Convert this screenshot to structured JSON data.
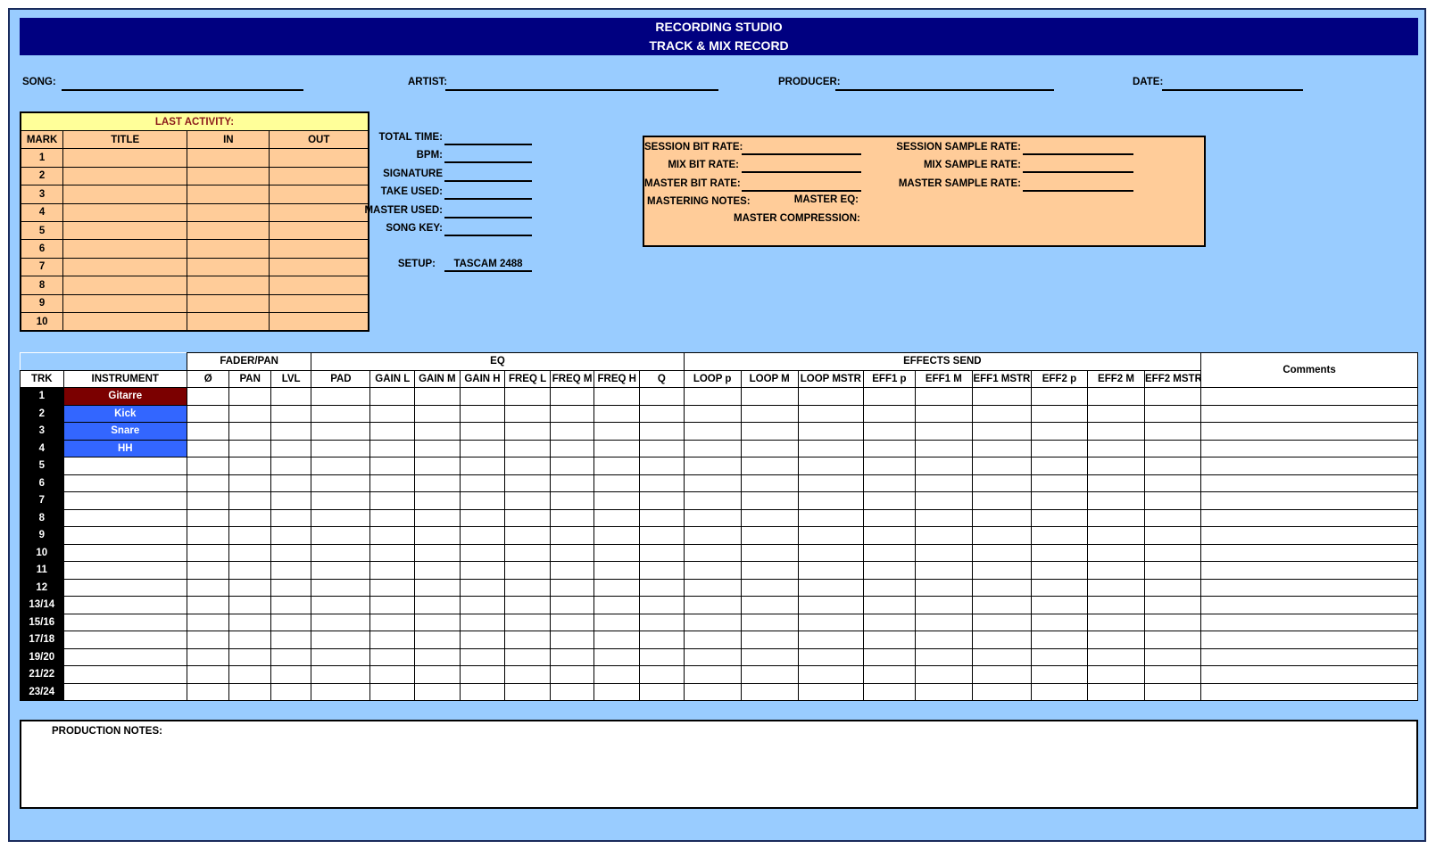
{
  "banner": {
    "line1": "RECORDING STUDIO",
    "line2": "TRACK & MIX RECORD"
  },
  "header_fields": {
    "song": "SONG:",
    "artist": "ARTIST:",
    "producer": "PRODUCER:",
    "date": "DATE:"
  },
  "last_activity": {
    "title": "LAST ACTIVITY:",
    "columns": [
      "MARK",
      "TITLE",
      "IN",
      "OUT"
    ],
    "marks": [
      "1",
      "2",
      "3",
      "4",
      "5",
      "6",
      "7",
      "8",
      "9",
      "10"
    ]
  },
  "song_info": {
    "total_time": "TOTAL TIME:",
    "bpm": "BPM:",
    "signature": "SIGNATURE",
    "take_used": "TAKE USED:",
    "master_used": "MASTER USED:",
    "song_key": "SONG KEY:",
    "setup_label": "SETUP:",
    "setup_value": "TASCAM 2488"
  },
  "rates": {
    "session_bit_rate": "SESSION BIT RATE:",
    "mix_bit_rate": "MIX BIT RATE:",
    "master_bit_rate": "MASTER BIT RATE:",
    "mastering_notes": "MASTERING NOTES:",
    "session_sample_rate": "SESSION SAMPLE RATE:",
    "mix_sample_rate": "MIX SAMPLE RATE:",
    "master_sample_rate": "MASTER SAMPLE RATE:",
    "master_eq": "MASTER EQ:",
    "master_compression": "MASTER COMPRESSION:"
  },
  "track_table": {
    "groups": {
      "fader_pan": "FADER/PAN",
      "eq": "EQ",
      "effects_send": "EFFECTS SEND",
      "comments": "Comments"
    },
    "columns": [
      "TRK",
      "INSTRUMENT",
      "Ø",
      "PAN",
      "LVL",
      "PAD",
      "GAIN L",
      "GAIN M",
      "GAIN H",
      "FREQ L",
      "FREQ M",
      "FREQ H",
      "Q",
      "LOOP p",
      "LOOP M",
      "LOOP MSTR",
      "EFF1 p",
      "EFF1  M",
      "EFF1 MSTR",
      "EFF2 p",
      "EFF2 M",
      "EFF2 MSTR"
    ],
    "rows": [
      {
        "trk": "1",
        "instrument": "Gitarre",
        "color": "#7b0000"
      },
      {
        "trk": "2",
        "instrument": "Kick",
        "color": "#3366ff"
      },
      {
        "trk": "3",
        "instrument": "Snare",
        "color": "#3366ff"
      },
      {
        "trk": "4",
        "instrument": "HH",
        "color": "#3366ff"
      },
      {
        "trk": "5",
        "instrument": ""
      },
      {
        "trk": "6",
        "instrument": ""
      },
      {
        "trk": "7",
        "instrument": ""
      },
      {
        "trk": "8",
        "instrument": ""
      },
      {
        "trk": "9",
        "instrument": ""
      },
      {
        "trk": "10",
        "instrument": ""
      },
      {
        "trk": "11",
        "instrument": ""
      },
      {
        "trk": "12",
        "instrument": ""
      },
      {
        "trk": "13/14",
        "instrument": ""
      },
      {
        "trk": "15/16",
        "instrument": ""
      },
      {
        "trk": "17/18",
        "instrument": ""
      },
      {
        "trk": "19/20",
        "instrument": ""
      },
      {
        "trk": "21/22",
        "instrument": ""
      },
      {
        "trk": "23/24",
        "instrument": ""
      }
    ]
  },
  "production_notes": {
    "label": "PRODUCTION NOTES:"
  },
  "colors": {
    "background": "#99ccff",
    "banner": "#000080",
    "peach": "#ffcc99",
    "yellow": "#ffff99"
  }
}
